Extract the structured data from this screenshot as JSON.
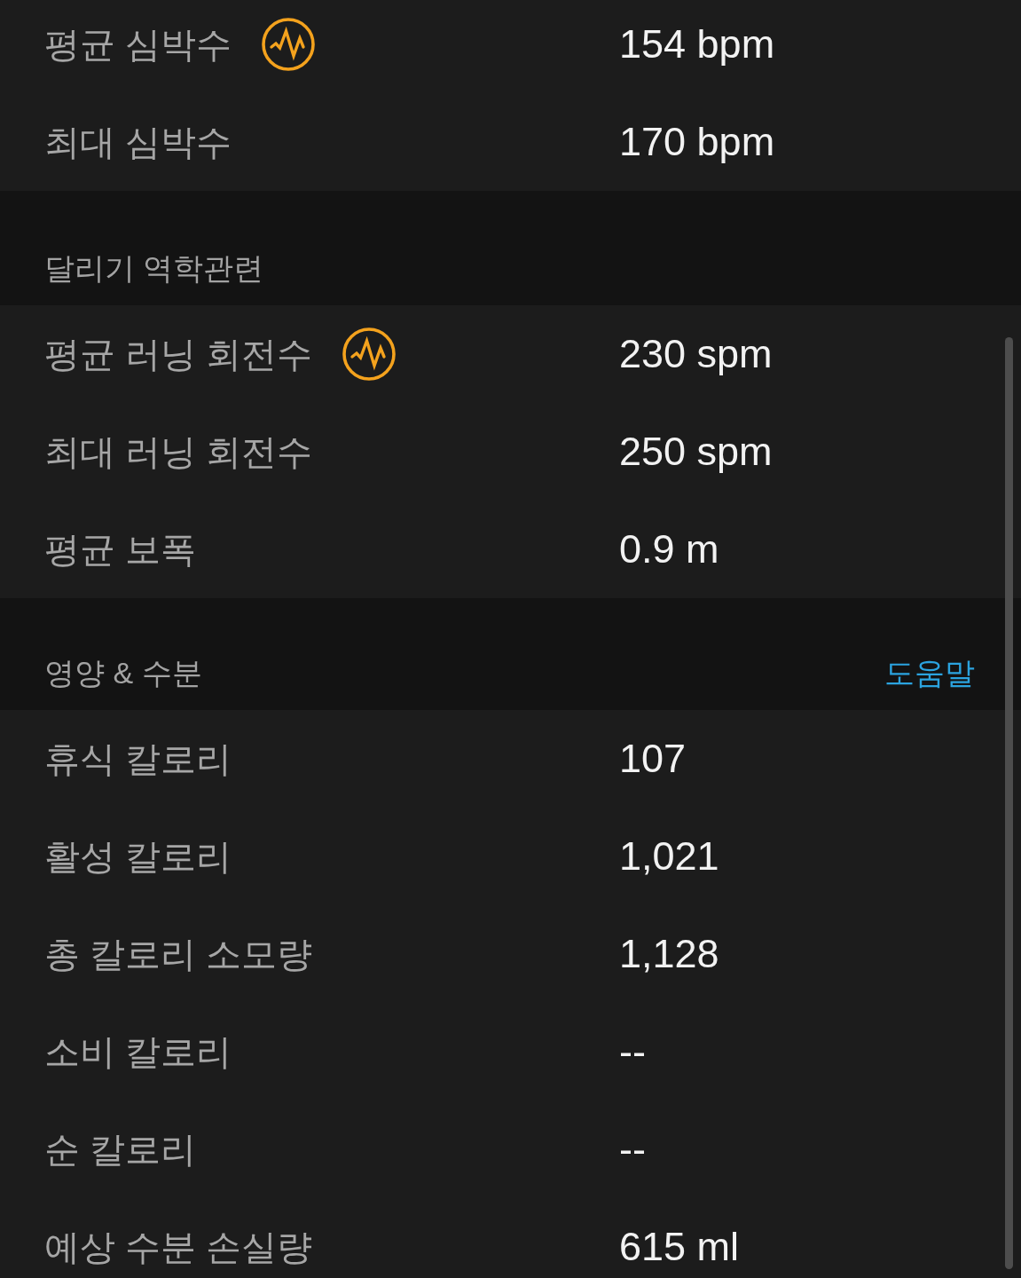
{
  "sections": [
    {
      "rows": [
        {
          "label": "평균 심박수",
          "value": "154 bpm",
          "pulse_icon": true
        },
        {
          "label": "최대 심박수",
          "value": "170 bpm",
          "pulse_icon": false
        }
      ]
    },
    {
      "header": "달리기 역학관련",
      "rows": [
        {
          "label": "평균 러닝 회전수",
          "value": "230 spm",
          "pulse_icon": true
        },
        {
          "label": "최대 러닝 회전수",
          "value": "250 spm",
          "pulse_icon": false
        },
        {
          "label": "평균 보폭",
          "value": "0.9 m",
          "pulse_icon": false
        }
      ]
    },
    {
      "header": "영양 & 수분",
      "help_link": "도움말",
      "rows": [
        {
          "label": "휴식 칼로리",
          "value": "107",
          "pulse_icon": false
        },
        {
          "label": "활성 칼로리",
          "value": "1,021",
          "pulse_icon": false
        },
        {
          "label": "총 칼로리 소모량",
          "value": "1,128",
          "pulse_icon": false
        },
        {
          "label": "소비 칼로리",
          "value": "--",
          "pulse_icon": false
        },
        {
          "label": "순 칼로리",
          "value": "--",
          "pulse_icon": false
        },
        {
          "label": "예상 수분 손실량",
          "value": "615 ml",
          "pulse_icon": false
        }
      ]
    }
  ]
}
